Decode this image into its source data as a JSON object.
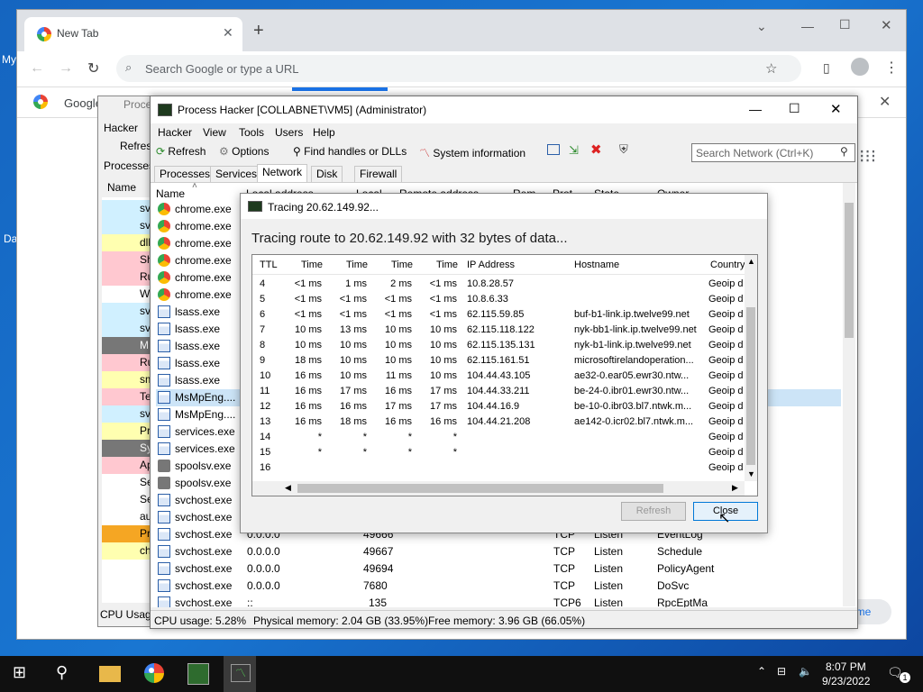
{
  "desktop": {
    "label_my": "My",
    "label_da": "Da"
  },
  "browser": {
    "tab_title": "New Tab",
    "omnibox_placeholder": "Search Google or type a URL",
    "bookmark_label": "Google",
    "new_tab_label": "ome"
  },
  "bg_window": {
    "title": "Proce",
    "menu": "Hacker",
    "refresh": "Refres",
    "tab": "Processes",
    "column": "Name",
    "rows": [
      "sv",
      "sv",
      "dll",
      "Sh",
      "Ru",
      "W",
      "sv",
      "sv",
      "M",
      "Ru",
      "sm",
      "Te",
      "sv",
      "Pr",
      "Sy",
      "Ap",
      "Se",
      "Se",
      "au",
      "Pr",
      "ch"
    ],
    "status": "CPU Usage"
  },
  "window": {
    "title": "Process Hacker [COLLABNET\\VM5] (Administrator)",
    "menu": [
      "Hacker",
      "View",
      "Tools",
      "Users",
      "Help"
    ],
    "toolbar": {
      "refresh": "Refresh",
      "options": "Options",
      "find": "Find handles or DLLs",
      "sysinfo": "System information"
    },
    "search_placeholder": "Search Network (Ctrl+K)",
    "tabs": [
      "Processes",
      "Services",
      "Network",
      "Disk",
      "Firewall"
    ],
    "columns": {
      "name": "Name",
      "local_address": "Local address",
      "local": "Local",
      "remote_address": "Remote address",
      "rem": "Rem",
      "prot": "Prot",
      "state": "State",
      "owner": "Owner"
    },
    "processes": [
      "chrome.exe",
      "chrome.exe",
      "chrome.exe",
      "chrome.exe",
      "chrome.exe",
      "chrome.exe",
      "lsass.exe",
      "lsass.exe",
      "lsass.exe",
      "lsass.exe",
      "lsass.exe",
      "MsMpEng....",
      "MsMpEng....",
      "services.exe",
      "services.exe",
      "spoolsv.exe",
      "spoolsv.exe",
      "svchost.exe",
      "svchost.exe"
    ],
    "bottom_rows": [
      {
        "name": "svchost.exe",
        "addr": "0.0.0.0",
        "port": "49666",
        "prot": "TCP",
        "state": "Listen",
        "owner": "EventLog"
      },
      {
        "name": "svchost.exe",
        "addr": "0.0.0.0",
        "port": "49667",
        "prot": "TCP",
        "state": "Listen",
        "owner": "Schedule"
      },
      {
        "name": "svchost.exe",
        "addr": "0.0.0.0",
        "port": "49694",
        "prot": "TCP",
        "state": "Listen",
        "owner": "PolicyAgent"
      },
      {
        "name": "svchost.exe",
        "addr": "0.0.0.0",
        "port": "7680",
        "prot": "TCP",
        "state": "Listen",
        "owner": "DoSvc"
      },
      {
        "name": "svchost.exe",
        "addr": "::",
        "port": "135",
        "prot": "TCP6",
        "state": "Listen",
        "owner": "RpcEptMa"
      }
    ],
    "status": {
      "cpu": "CPU usage: 5.28%",
      "physical": "Physical memory: 2.04 GB (33.95%)",
      "free": "Free memory: 3.96 GB (66.05%)"
    }
  },
  "dialog": {
    "title": "Tracing 20.62.149.92...",
    "heading": "Tracing route to 20.62.149.92 with 32 bytes of data...",
    "columns": [
      "TTL",
      "Time",
      "Time",
      "Time",
      "Time",
      "IP Address",
      "Hostname",
      "Country"
    ],
    "rows": [
      [
        "4",
        "<1 ms",
        "1 ms",
        "2 ms",
        "<1 ms",
        "10.8.28.57",
        "",
        "Geoip d"
      ],
      [
        "5",
        "<1 ms",
        "<1 ms",
        "<1 ms",
        "<1 ms",
        "10.8.6.33",
        "",
        "Geoip d"
      ],
      [
        "6",
        "<1 ms",
        "<1 ms",
        "<1 ms",
        "<1 ms",
        "62.115.59.85",
        "buf-b1-link.ip.twelve99.net",
        "Geoip d"
      ],
      [
        "7",
        "10 ms",
        "13 ms",
        "10 ms",
        "10 ms",
        "62.115.118.122",
        "nyk-bb1-link.ip.twelve99.net",
        "Geoip d"
      ],
      [
        "8",
        "10 ms",
        "10 ms",
        "10 ms",
        "10 ms",
        "62.115.135.131",
        "nyk-b1-link.ip.twelve99.net",
        "Geoip d"
      ],
      [
        "9",
        "18 ms",
        "10 ms",
        "10 ms",
        "10 ms",
        "62.115.161.51",
        "microsoftirelandoperation...",
        "Geoip d"
      ],
      [
        "10",
        "16 ms",
        "10 ms",
        "11 ms",
        "10 ms",
        "104.44.43.105",
        "ae32-0.ear05.ewr30.ntw...",
        "Geoip d"
      ],
      [
        "11",
        "16 ms",
        "17 ms",
        "16 ms",
        "17 ms",
        "104.44.33.211",
        "be-24-0.ibr01.ewr30.ntw...",
        "Geoip d"
      ],
      [
        "12",
        "16 ms",
        "16 ms",
        "17 ms",
        "17 ms",
        "104.44.16.9",
        "be-10-0.ibr03.bl7.ntwk.m...",
        "Geoip d"
      ],
      [
        "13",
        "16 ms",
        "18 ms",
        "16 ms",
        "16 ms",
        "104.44.21.208",
        "ae142-0.icr02.bl7.ntwk.m...",
        "Geoip d"
      ],
      [
        "14",
        "*",
        "*",
        "*",
        "*",
        "",
        "",
        "Geoip d"
      ],
      [
        "15",
        "*",
        "*",
        "*",
        "*",
        "",
        "",
        "Geoip d"
      ],
      [
        "16",
        "",
        "",
        "",
        "",
        "",
        "",
        "Geoip d"
      ]
    ],
    "refresh_label": "Refresh",
    "close_label": "Close"
  },
  "taskbar": {
    "time": "8:07 PM",
    "date": "9/23/2022",
    "notif_count": "1"
  }
}
